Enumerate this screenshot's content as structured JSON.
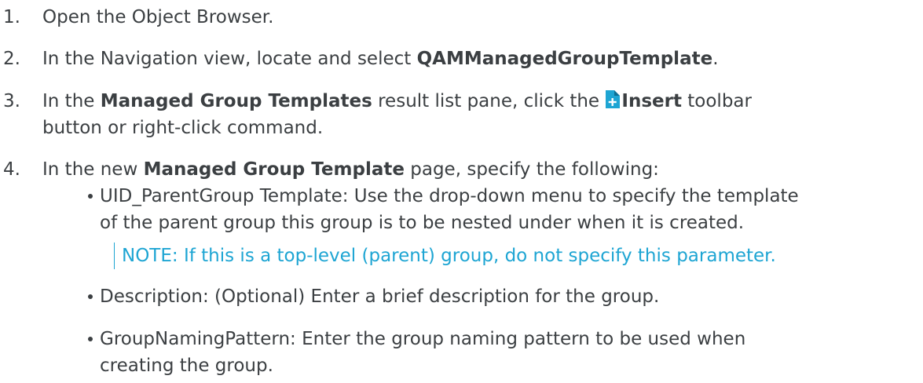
{
  "steps": [
    {
      "num": "1.",
      "text": "Open the Object Browser."
    },
    {
      "num": "2.",
      "pre": "In the Navigation view, locate and select ",
      "bold": "QAMManagedGroupTemplate",
      "post": "."
    },
    {
      "num": "3.",
      "pre": "In the ",
      "bold": "Managed Group Templates",
      "mid": " result list pane, click the ",
      "icon": "insert-icon",
      "bold2": "Insert",
      "post": " toolbar",
      "cont": "button or right-click command."
    },
    {
      "num": "4.",
      "pre": "In the new ",
      "bold": "Managed Group Template",
      "post": " page, specify the following:"
    }
  ],
  "bullets": [
    {
      "line1": "UID_ParentGroup Template: Use the drop-down menu to specify the template",
      "line2": "of the parent group this group is to be nested under when it is created."
    },
    {
      "line1": "Description: (Optional) Enter a brief description for the group."
    },
    {
      "line1": "GroupNamingPattern: Enter the group naming pattern to be used when",
      "line2": "creating the group."
    }
  ],
  "note": {
    "label": "NOTE:",
    "text": " If this is a top-level (parent) group, do not specify this parameter."
  },
  "colors": {
    "text": "#3b3f42",
    "note": "#1ea5d3",
    "icon_page": "#1ea5d3",
    "icon_plus": "#ffffff"
  }
}
